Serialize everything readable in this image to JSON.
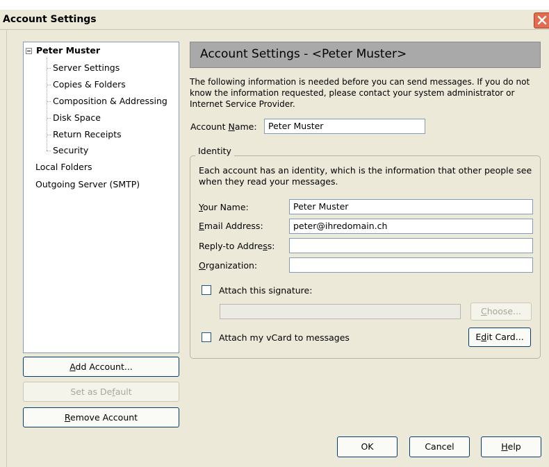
{
  "window": {
    "title": "Account Settings"
  },
  "tree": {
    "root": "Peter Muster",
    "children": [
      "Server Settings",
      "Copies & Folders",
      "Composition & Addressing",
      "Disk Space",
      "Return Receipts",
      "Security"
    ],
    "others": [
      "Local Folders",
      "Outgoing Server (SMTP)"
    ]
  },
  "buttons": {
    "add_account": {
      "pre": "",
      "key": "A",
      "post": "dd Account..."
    },
    "set_default": {
      "pre": "Set as De",
      "key": "f",
      "post": "ault"
    },
    "remove_account": {
      "pre": "",
      "key": "R",
      "post": "emove Account"
    },
    "ok": "OK",
    "cancel": "Cancel",
    "help": {
      "pre": "",
      "key": "H",
      "post": "elp"
    },
    "choose": {
      "pre": "",
      "key": "C",
      "post": "hoose..."
    },
    "edit_card": {
      "pre": "E",
      "key": "d",
      "post": "it Card..."
    }
  },
  "panel": {
    "header": "Account Settings - <Peter Muster>",
    "intro": "The following information is needed before you can send messages. If you do not know the information requested, please contact your system administrator or Internet Service Provider.",
    "account_name_label": {
      "pre": "Account ",
      "key": "N",
      "post": "ame:"
    },
    "account_name_value": "Peter Muster"
  },
  "identity": {
    "legend": "Identity",
    "description": "Each account has an identity, which is the information that other people see when they read your messages.",
    "your_name_label": {
      "pre": "",
      "key": "Y",
      "post": "our Name:"
    },
    "your_name_value": "Peter Muster",
    "email_label": {
      "pre": "",
      "key": "E",
      "post": "mail Address:"
    },
    "email_value": "peter@ihredomain.ch",
    "reply_to_label": {
      "pre": "Reply-to Addre",
      "key": "s",
      "post": "s:"
    },
    "reply_to_value": "",
    "organization_label": {
      "pre": "",
      "key": "O",
      "post": "rganization:"
    },
    "organization_value": "",
    "attach_signature_label": "Attach this signature:",
    "signature_path": "",
    "attach_vcard_label": "Attach my vCard to messages"
  },
  "colors": {
    "close_button": "#e26c4f",
    "header_bg": "#a9a9a9",
    "dialog_bg": "#ece9d8"
  }
}
